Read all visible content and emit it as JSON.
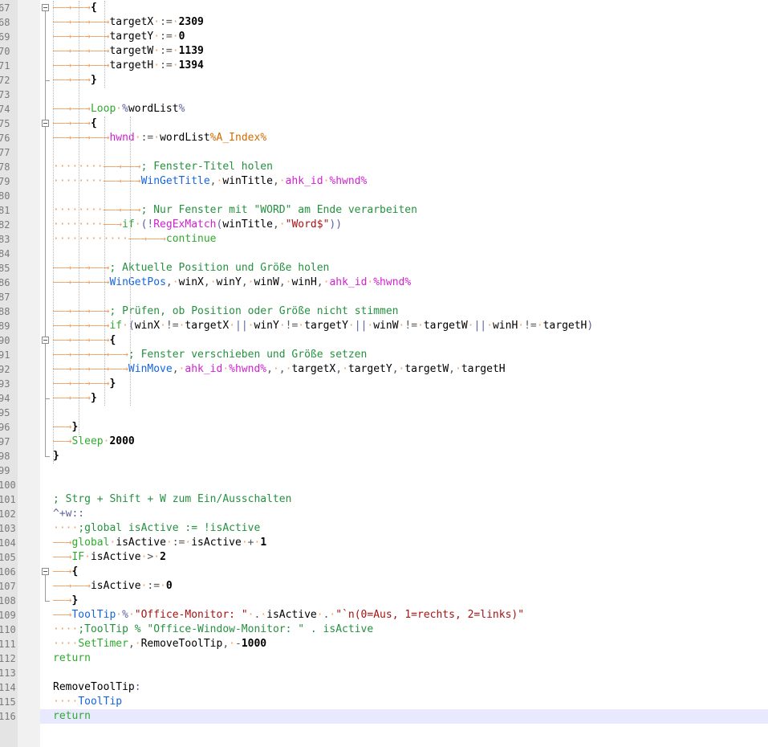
{
  "editor": {
    "start_line_number": 67,
    "current_line": 116,
    "lines": [
      [
        [
          "ws",
          "——→——→"
        ],
        [
          "b",
          "{"
        ]
      ],
      [
        [
          "ws",
          "——→——→——→"
        ],
        [
          "t",
          "targetX"
        ],
        [
          "dot",
          "·"
        ],
        [
          "o",
          ":="
        ],
        [
          "dot",
          "·"
        ],
        [
          "n",
          "2309"
        ]
      ],
      [
        [
          "ws",
          "——→——→——→"
        ],
        [
          "t",
          "targetY"
        ],
        [
          "dot",
          "·"
        ],
        [
          "o",
          ":="
        ],
        [
          "dot",
          "·"
        ],
        [
          "n",
          "0"
        ]
      ],
      [
        [
          "ws",
          "——→——→——→"
        ],
        [
          "t",
          "targetW"
        ],
        [
          "dot",
          "·"
        ],
        [
          "o",
          ":="
        ],
        [
          "dot",
          "·"
        ],
        [
          "n",
          "1139"
        ]
      ],
      [
        [
          "ws",
          "——→——→——→"
        ],
        [
          "t",
          "targetH"
        ],
        [
          "dot",
          "·"
        ],
        [
          "o",
          ":="
        ],
        [
          "dot",
          "·"
        ],
        [
          "n",
          "1394"
        ]
      ],
      [
        [
          "ws",
          "——→——→"
        ],
        [
          "b",
          "}"
        ]
      ],
      [],
      [
        [
          "ws",
          "——→——→"
        ],
        [
          "k",
          "Loop"
        ],
        [
          "dot",
          "·"
        ],
        [
          "p",
          "%"
        ],
        [
          "t",
          "wordList"
        ],
        [
          "p",
          "%"
        ]
      ],
      [
        [
          "ws",
          "——→——→"
        ],
        [
          "b",
          "{"
        ]
      ],
      [
        [
          "ws",
          "——→——→——→"
        ],
        [
          "v",
          "hwnd"
        ],
        [
          "dot",
          "·"
        ],
        [
          "o",
          ":="
        ],
        [
          "dot",
          "·"
        ],
        [
          "t",
          "wordList"
        ],
        [
          "bv",
          "%A_Index%"
        ]
      ],
      [],
      [
        [
          "ws",
          "········——→——→"
        ],
        [
          "c",
          "; Fenster-Titel holen"
        ]
      ],
      [
        [
          "ws",
          "········——→——→"
        ],
        [
          "f",
          "WinGetTitle"
        ],
        [
          "o",
          ","
        ],
        [
          "dot",
          "·"
        ],
        [
          "t",
          "winTitle"
        ],
        [
          "o",
          ","
        ],
        [
          "dot",
          "·"
        ],
        [
          "v",
          "ahk_id"
        ],
        [
          "dot",
          "·"
        ],
        [
          "v",
          "%hwnd%"
        ]
      ],
      [],
      [
        [
          "ws",
          "········——→——→"
        ],
        [
          "c",
          "; Nur Fenster mit \"WORD\" am Ende verarbeiten"
        ]
      ],
      [
        [
          "ws",
          "········——→"
        ],
        [
          "k",
          "if"
        ],
        [
          "dot",
          "·"
        ],
        [
          "p",
          "(!"
        ],
        [
          "v",
          "RegExMatch"
        ],
        [
          "p",
          "("
        ],
        [
          "t",
          "winTitle"
        ],
        [
          "o",
          ","
        ],
        [
          "dot",
          "·"
        ],
        [
          "s",
          "\"Word$\""
        ],
        [
          "p",
          "))"
        ]
      ],
      [
        [
          "ws",
          "············——→——→"
        ],
        [
          "k",
          "continue"
        ]
      ],
      [],
      [
        [
          "ws",
          "——→——→——→"
        ],
        [
          "c",
          "; Aktuelle Position und Größe holen"
        ]
      ],
      [
        [
          "ws",
          "——→——→——→"
        ],
        [
          "f",
          "WinGetPos"
        ],
        [
          "o",
          ","
        ],
        [
          "dot",
          "·"
        ],
        [
          "t",
          "winX"
        ],
        [
          "o",
          ","
        ],
        [
          "dot",
          "·"
        ],
        [
          "t",
          "winY"
        ],
        [
          "o",
          ","
        ],
        [
          "dot",
          "·"
        ],
        [
          "t",
          "winW"
        ],
        [
          "o",
          ","
        ],
        [
          "dot",
          "·"
        ],
        [
          "t",
          "winH"
        ],
        [
          "o",
          ","
        ],
        [
          "dot",
          "·"
        ],
        [
          "v",
          "ahk_id"
        ],
        [
          "dot",
          "·"
        ],
        [
          "v",
          "%hwnd%"
        ]
      ],
      [],
      [
        [
          "ws",
          "——→——→——→"
        ],
        [
          "c",
          "; Prüfen, ob Position oder Größe nicht stimmen"
        ]
      ],
      [
        [
          "ws",
          "——→——→——→"
        ],
        [
          "k",
          "if"
        ],
        [
          "dot",
          "·"
        ],
        [
          "p",
          "("
        ],
        [
          "t",
          "winX"
        ],
        [
          "dot",
          "·"
        ],
        [
          "o",
          "!="
        ],
        [
          "dot",
          "·"
        ],
        [
          "t",
          "targetX"
        ],
        [
          "dot",
          "·"
        ],
        [
          "p",
          "||"
        ],
        [
          "dot",
          "·"
        ],
        [
          "t",
          "winY"
        ],
        [
          "dot",
          "·"
        ],
        [
          "o",
          "!="
        ],
        [
          "dot",
          "·"
        ],
        [
          "t",
          "targetY"
        ],
        [
          "dot",
          "·"
        ],
        [
          "p",
          "||"
        ],
        [
          "dot",
          "·"
        ],
        [
          "t",
          "winW"
        ],
        [
          "dot",
          "·"
        ],
        [
          "o",
          "!="
        ],
        [
          "dot",
          "·"
        ],
        [
          "t",
          "targetW"
        ],
        [
          "dot",
          "·"
        ],
        [
          "p",
          "||"
        ],
        [
          "dot",
          "·"
        ],
        [
          "t",
          "winH"
        ],
        [
          "dot",
          "·"
        ],
        [
          "o",
          "!="
        ],
        [
          "dot",
          "·"
        ],
        [
          "t",
          "targetH"
        ],
        [
          "p",
          ")"
        ]
      ],
      [
        [
          "ws",
          "——→——→——→"
        ],
        [
          "b",
          "{"
        ]
      ],
      [
        [
          "ws",
          "——→——→——→——→"
        ],
        [
          "c",
          "; Fenster verschieben und Größe setzen"
        ]
      ],
      [
        [
          "ws",
          "——→——→——→——→"
        ],
        [
          "f",
          "WinMove"
        ],
        [
          "o",
          ","
        ],
        [
          "dot",
          "·"
        ],
        [
          "v",
          "ahk_id"
        ],
        [
          "dot",
          "·"
        ],
        [
          "v",
          "%hwnd%"
        ],
        [
          "o",
          ","
        ],
        [
          "dot",
          "·"
        ],
        [
          "o",
          ","
        ],
        [
          "dot",
          "·"
        ],
        [
          "t",
          "targetX"
        ],
        [
          "o",
          ","
        ],
        [
          "dot",
          "·"
        ],
        [
          "t",
          "targetY"
        ],
        [
          "o",
          ","
        ],
        [
          "dot",
          "·"
        ],
        [
          "t",
          "targetW"
        ],
        [
          "o",
          ","
        ],
        [
          "dot",
          "·"
        ],
        [
          "t",
          "targetH"
        ]
      ],
      [
        [
          "ws",
          "——→——→——→"
        ],
        [
          "b",
          "}"
        ]
      ],
      [
        [
          "ws",
          "——→——→"
        ],
        [
          "b",
          "}"
        ]
      ],
      [],
      [
        [
          "ws",
          "——→"
        ],
        [
          "b",
          "}"
        ]
      ],
      [
        [
          "ws",
          "——→"
        ],
        [
          "k",
          "Sleep"
        ],
        [
          "dot",
          "·"
        ],
        [
          "n",
          "2000"
        ]
      ],
      [
        [
          "b",
          "}"
        ]
      ],
      [],
      [],
      [
        [
          "c",
          "; Strg + Shift + W zum Ein/Ausschalten"
        ]
      ],
      [
        [
          "p",
          "^+w::"
        ]
      ],
      [
        [
          "ws",
          "····"
        ],
        [
          "c",
          ";global isActive := !isActive"
        ]
      ],
      [
        [
          "ws",
          "——→"
        ],
        [
          "k",
          "global"
        ],
        [
          "dot",
          "·"
        ],
        [
          "t",
          "isActive"
        ],
        [
          "dot",
          "·"
        ],
        [
          "o",
          ":="
        ],
        [
          "dot",
          "·"
        ],
        [
          "t",
          "isActive"
        ],
        [
          "dot",
          "·"
        ],
        [
          "o",
          "+"
        ],
        [
          "dot",
          "·"
        ],
        [
          "n",
          "1"
        ]
      ],
      [
        [
          "ws",
          "——→"
        ],
        [
          "k",
          "IF"
        ],
        [
          "dot",
          "·"
        ],
        [
          "t",
          "isActive"
        ],
        [
          "dot",
          "·"
        ],
        [
          "o",
          ">"
        ],
        [
          "dot",
          "·"
        ],
        [
          "n",
          "2"
        ]
      ],
      [
        [
          "ws",
          "——→"
        ],
        [
          "b",
          "{"
        ]
      ],
      [
        [
          "ws",
          "——→——→"
        ],
        [
          "t",
          "isActive"
        ],
        [
          "dot",
          "·"
        ],
        [
          "o",
          ":="
        ],
        [
          "dot",
          "·"
        ],
        [
          "n",
          "0"
        ]
      ],
      [
        [
          "ws",
          "——→"
        ],
        [
          "b",
          "}"
        ]
      ],
      [
        [
          "ws",
          "——→"
        ],
        [
          "f",
          "ToolTip"
        ],
        [
          "dot",
          "·"
        ],
        [
          "p",
          "%"
        ],
        [
          "dot",
          "·"
        ],
        [
          "s",
          "\"Office-Monitor: \""
        ],
        [
          "dot",
          "·"
        ],
        [
          "o",
          "."
        ],
        [
          "dot",
          "·"
        ],
        [
          "t",
          "isActive"
        ],
        [
          "dot",
          "·"
        ],
        [
          "o",
          "."
        ],
        [
          "dot",
          "·"
        ],
        [
          "s",
          "\"`n(0=Aus, 1=rechts, 2=links)\""
        ]
      ],
      [
        [
          "ws",
          "····"
        ],
        [
          "c",
          ";ToolTip % \"Office-Window-Monitor: \" . isActive"
        ]
      ],
      [
        [
          "ws",
          "····"
        ],
        [
          "k",
          "SetTimer"
        ],
        [
          "o",
          ","
        ],
        [
          "dot",
          "·"
        ],
        [
          "t",
          "RemoveToolTip"
        ],
        [
          "o",
          ","
        ],
        [
          "dot",
          "·"
        ],
        [
          "o",
          "-"
        ],
        [
          "n",
          "1000"
        ]
      ],
      [
        [
          "k",
          "return"
        ]
      ],
      [],
      [
        [
          "t",
          "RemoveToolTip"
        ],
        [
          "p",
          ":"
        ]
      ],
      [
        [
          "ws",
          "····"
        ],
        [
          "f",
          "ToolTip"
        ]
      ],
      [
        [
          "k",
          "return"
        ]
      ]
    ]
  }
}
